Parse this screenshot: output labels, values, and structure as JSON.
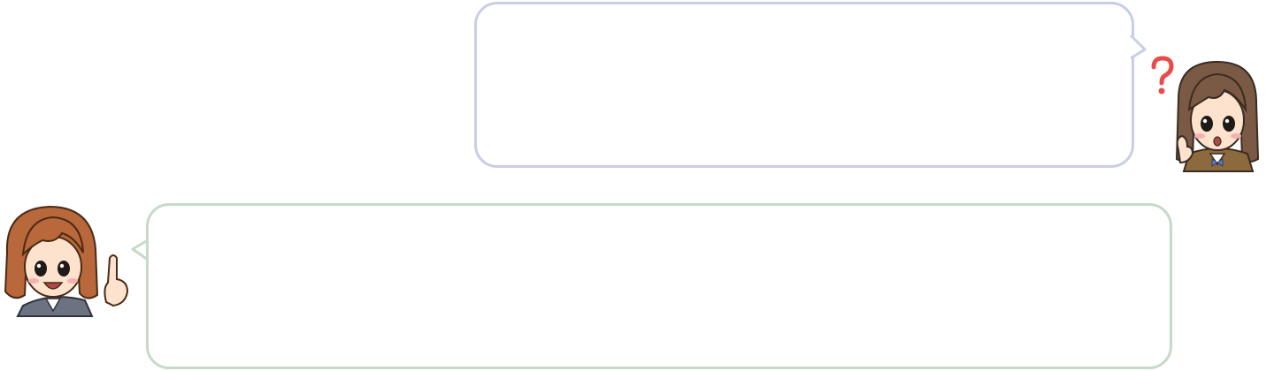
{
  "dialogue": {
    "top_bubble": {
      "speaker": "student",
      "text": "",
      "border_color": "#c9cde6"
    },
    "bottom_bubble": {
      "speaker": "teacher",
      "text": "",
      "border_color": "#c6dac8"
    }
  },
  "icons": {
    "student": "student-avatar-icon",
    "teacher": "teacher-avatar-icon",
    "question": "question-mark-icon"
  },
  "colors": {
    "question_mark": "#e94b4b",
    "student_hair": "#7a5a45",
    "teacher_hair": "#b8683a",
    "uniform_brown": "#8d6a3e",
    "suit_gray": "#6b7282",
    "skin": "#fde3cd"
  }
}
